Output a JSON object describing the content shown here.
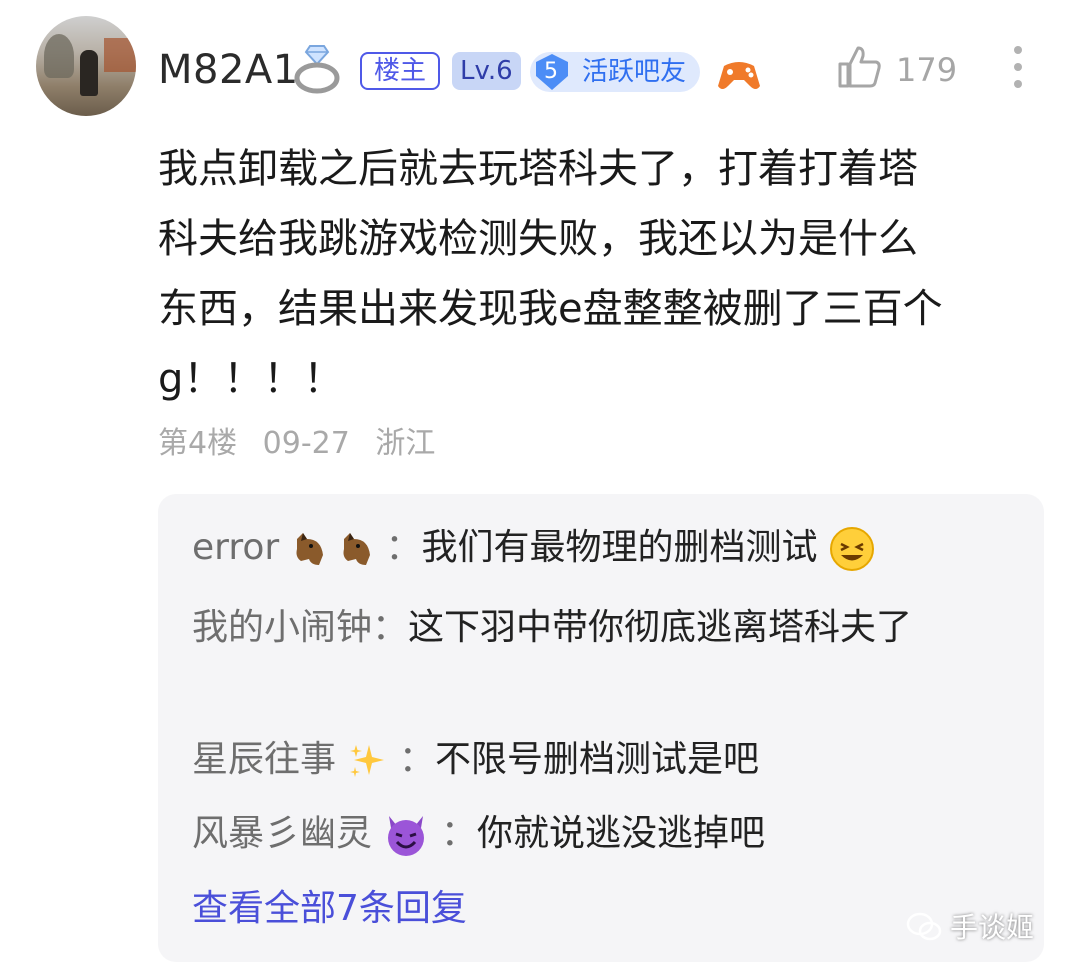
{
  "post": {
    "username": "M82A1",
    "badges": {
      "owner": "楼主",
      "level": "Lv.6",
      "active_num": "5",
      "active_label": "活跃吧友"
    },
    "like_count": "179",
    "text": "我点卸载之后就去玩塔科夫了，打着打着塔\n科夫给我跳游戏检测失败，我还以为是什么\n东西，结果出来发现我e盘整整被删了三百个\ng！！！！",
    "meta": {
      "floor": "第4楼",
      "date": "09-27",
      "location": "浙江"
    }
  },
  "replies": [
    {
      "user": "error",
      "content": "我们有最物理的删档测试"
    },
    {
      "user": "我的小闹钟",
      "content": "这下羽中带你彻底逃离塔科夫了"
    },
    {
      "user": "星辰往事",
      "content": "不限号删档测试是吧"
    },
    {
      "user": "风暴彡幽灵",
      "content": "你就说逃没逃掉吧"
    }
  ],
  "view_all": "查看全部7条回复",
  "watermark": "手谈姬",
  "colors": {
    "accent": "#4a4fd9",
    "owner_badge": "#4f59e8",
    "active_badge_bg": "#dfe9fd",
    "reply_bg": "#f5f5f7",
    "muted": "#a9a9a9"
  },
  "icons": [
    "diamond-ring-icon",
    "shield-5-icon",
    "gamepad-icon",
    "thumbs-up-icon",
    "more-vertical-icon",
    "horse-face-icon",
    "grinning-squint-icon",
    "sparkles-icon",
    "smiling-devil-icon",
    "wechat-icon"
  ]
}
